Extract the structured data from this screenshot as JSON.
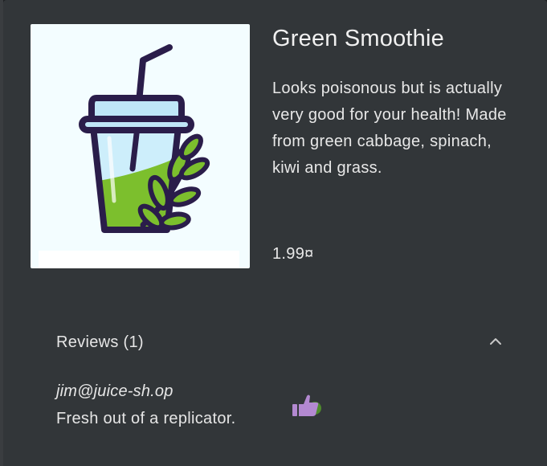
{
  "product": {
    "name": "Green Smoothie",
    "description": "Looks poisonous but is actually very good for your health! Made from green cabbage, spinach, kiwi and grass.",
    "price": "1.99¤",
    "image_icon": "green-smoothie-cup-icon"
  },
  "reviews": {
    "header": "Reviews (1)",
    "expanded": true,
    "items": [
      {
        "author": "jim@juice-sh.op",
        "message": "Fresh out of a replicator.",
        "like_icon": "thumbs-up-icon"
      }
    ]
  },
  "colors": {
    "dialog_bg": "#323639",
    "text": "#e6e6e6",
    "like_purple": "#b389d1",
    "like_green": "#4e8b2c",
    "smoothie_green": "#7cbf2d",
    "outline": "#2a1d4a"
  }
}
